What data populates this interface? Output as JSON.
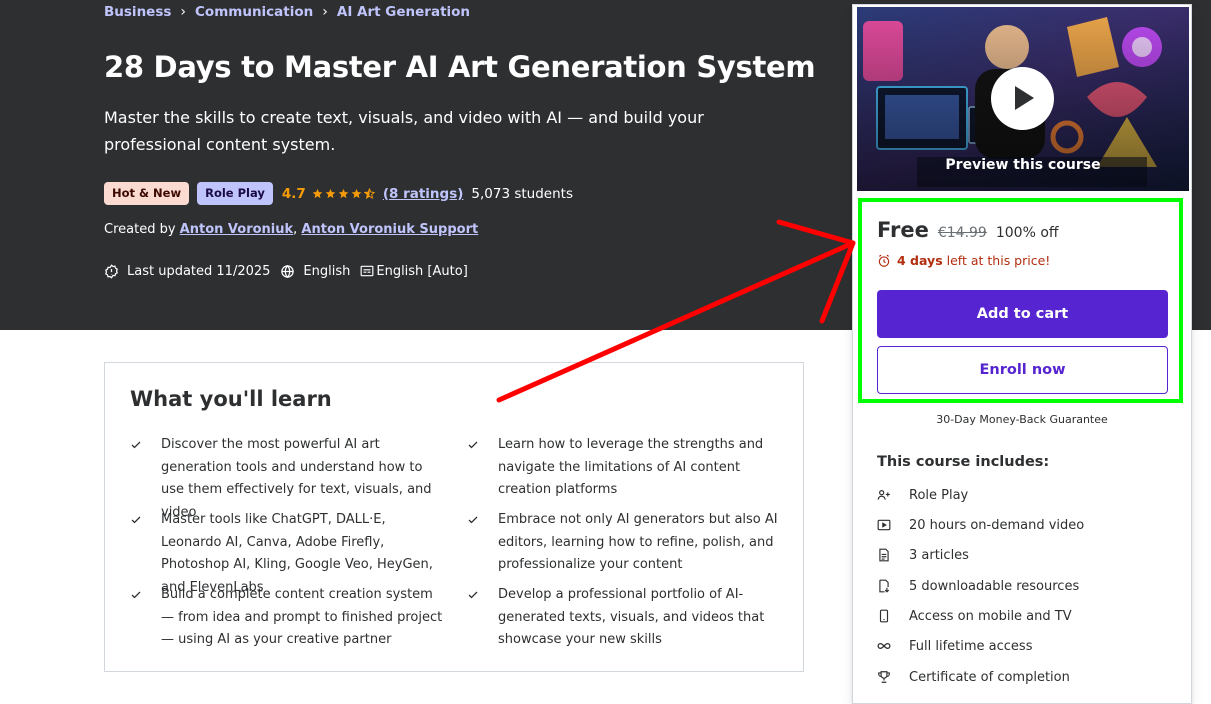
{
  "breadcrumb": [
    "Business",
    "Communication",
    "AI Art Generation"
  ],
  "course": {
    "title": "28 Days to Master AI Art Generation System",
    "subtitle": "Master the skills to create text, visuals, and video with AI — and build your professional content system.",
    "badges": [
      "Hot & New",
      "Role Play"
    ],
    "rating": "4.7",
    "rating_value": 4.7,
    "ratings_link": "(8 ratings)",
    "students": "5,073 students",
    "created_by_label": "Created by",
    "authors": [
      "Anton Voroniuk",
      "Anton Voroniuk Support"
    ],
    "last_updated": "Last updated 11/2025",
    "language": "English",
    "captions": "English [Auto]"
  },
  "learn": {
    "title": "What you'll learn",
    "items": [
      "Discover the most powerful AI art generation tools and understand how to use them effectively for text, visuals, and video",
      "Learn how to leverage the strengths and navigate the limitations of AI content creation platforms",
      "Master tools like ChatGPT, DALL·E, Leonardo AI, Canva, Adobe Firefly, Photoshop AI, Kling, Google Veo, HeyGen, and ElevenLabs",
      "Embrace not only AI generators but also AI editors, learning how to refine, polish, and professionalize your content",
      "Build a complete content creation system — from idea and prompt to finished project — using AI as your creative partner",
      "Develop a professional portfolio of AI-generated texts, visuals, and videos that showcase your new skills"
    ]
  },
  "sidebar": {
    "preview_label": "Preview this course",
    "price": "Free",
    "old_price": "€14.99",
    "discount": "100% off",
    "timer_days": "4 days",
    "timer_text": "left at this price!",
    "add_to_cart": "Add to cart",
    "enroll_now": "Enroll now",
    "guarantee": "30-Day Money-Back Guarantee",
    "includes_title": "This course includes:",
    "includes": [
      {
        "icon": "role-play-icon",
        "label": "Role Play"
      },
      {
        "icon": "video-icon",
        "label": "20 hours on-demand video"
      },
      {
        "icon": "article-icon",
        "label": "3 articles"
      },
      {
        "icon": "download-icon",
        "label": "5 downloadable resources"
      },
      {
        "icon": "mobile-icon",
        "label": "Access on mobile and TV"
      },
      {
        "icon": "infinity-icon",
        "label": "Full lifetime access"
      },
      {
        "icon": "trophy-icon",
        "label": "Certificate of completion"
      }
    ]
  },
  "colors": {
    "hero_bg": "#2d2f31",
    "link_purple": "#c0c4fc",
    "brand_purple": "#5624d0",
    "star": "#f69c08",
    "timer_red": "#b32d0f",
    "annotation_green": "#00ff00",
    "annotation_red": "#ff0000"
  }
}
